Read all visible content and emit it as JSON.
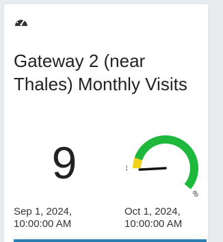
{
  "card": {
    "icon": "gauge-icon",
    "title": "Gateway 2 (near Thales) Monthly Visits",
    "value": "9",
    "start_date": "Sep 1, 2024, 10:00:00 AM",
    "end_date": "Oct 1, 2024, 10:00:00 AM"
  },
  "gauge": {
    "min_label": "10",
    "max_label": "80",
    "min": 10,
    "max": 80,
    "value": 9,
    "bands": [
      {
        "from": 10,
        "to": 16,
        "color": "#f1d21a"
      },
      {
        "from": 16,
        "to": 80,
        "color": "#1eb83c"
      }
    ],
    "needle_color": "#111111"
  }
}
